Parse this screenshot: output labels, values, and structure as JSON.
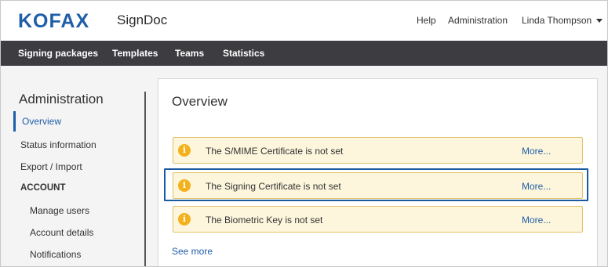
{
  "header": {
    "brand": "KOFAX",
    "app_name": "SignDoc",
    "links": {
      "help": "Help",
      "administration": "Administration"
    },
    "user": "Linda Thompson"
  },
  "nav": {
    "items": [
      "Signing packages",
      "Templates",
      "Teams",
      "Statistics"
    ]
  },
  "sidebar": {
    "title": "Administration",
    "items": {
      "overview": "Overview",
      "status": "Status information",
      "export": "Export / Import"
    },
    "section_account": "ACCOUNT",
    "account_items": {
      "manage_users": "Manage users",
      "account_details": "Account details",
      "notifications": "Notifications"
    }
  },
  "main": {
    "title": "Overview",
    "alerts": [
      {
        "message": "The S/MIME Certificate is not set",
        "link": "More..."
      },
      {
        "message": "The Signing Certificate is not set",
        "link": "More..."
      },
      {
        "message": "The Biometric Key is not set",
        "link": "More..."
      }
    ],
    "see_more": "See more"
  },
  "icons": {
    "alert": "info-warning-icon",
    "user_menu": "caret-down-icon"
  },
  "colors": {
    "brand": "#1f5ea8",
    "navbar": "#3c3c41",
    "alert_bg": "#fdf5dc",
    "alert_border": "#e2c36b",
    "warning": "#f3b21b",
    "highlight": "#1c5a9e"
  }
}
